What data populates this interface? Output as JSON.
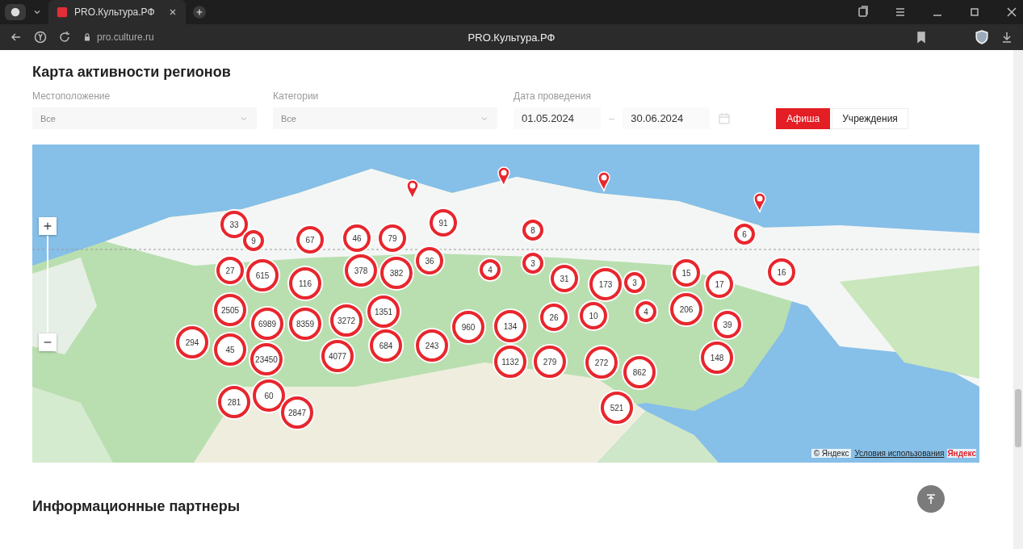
{
  "browser": {
    "tab_title": "PRO.Культура.РФ",
    "address": "pro.culture.ru",
    "page_title": "PRO.Культура.РФ"
  },
  "section_title": "Карта активности регионов",
  "filters": [
    {
      "kind": "select",
      "label": "Местоположение",
      "placeholder": "Все"
    },
    {
      "kind": "select",
      "label": "Категории",
      "placeholder": "Все"
    },
    {
      "kind": "dates",
      "label": "Дата проведения",
      "from": "01.05.2024",
      "separator": "–",
      "to": "30.06.2024"
    }
  ],
  "view_tabs": [
    {
      "label": "Афиша",
      "selected": true
    },
    {
      "label": "Учреждения",
      "selected": false
    }
  ],
  "map": {
    "markers": [
      {
        "kind": "pin"
      },
      {
        "kind": "pin"
      },
      {
        "kind": "pin"
      },
      {
        "kind": "pin"
      },
      {
        "kind": "cluster",
        "count": "33"
      },
      {
        "kind": "cluster",
        "count": "9"
      },
      {
        "kind": "cluster",
        "count": "67"
      },
      {
        "kind": "cluster",
        "count": "46"
      },
      {
        "kind": "cluster",
        "count": "79"
      },
      {
        "kind": "cluster",
        "count": "91"
      },
      {
        "kind": "cluster",
        "count": "8"
      },
      {
        "kind": "cluster",
        "count": "6"
      },
      {
        "kind": "cluster",
        "count": "27"
      },
      {
        "kind": "cluster",
        "count": "615"
      },
      {
        "kind": "cluster",
        "count": "116"
      },
      {
        "kind": "cluster",
        "count": "378"
      },
      {
        "kind": "cluster",
        "count": "382"
      },
      {
        "kind": "cluster",
        "count": "36"
      },
      {
        "kind": "cluster",
        "count": "4"
      },
      {
        "kind": "cluster",
        "count": "3"
      },
      {
        "kind": "cluster",
        "count": "31"
      },
      {
        "kind": "cluster",
        "count": "173"
      },
      {
        "kind": "cluster",
        "count": "3"
      },
      {
        "kind": "cluster",
        "count": "15"
      },
      {
        "kind": "cluster",
        "count": "17"
      },
      {
        "kind": "cluster",
        "count": "16"
      },
      {
        "kind": "cluster",
        "count": "2505"
      },
      {
        "kind": "cluster",
        "count": "6989"
      },
      {
        "kind": "cluster",
        "count": "8359"
      },
      {
        "kind": "cluster",
        "count": "3272"
      },
      {
        "kind": "cluster",
        "count": "1351"
      },
      {
        "kind": "cluster",
        "count": "960"
      },
      {
        "kind": "cluster",
        "count": "134"
      },
      {
        "kind": "cluster",
        "count": "26"
      },
      {
        "kind": "cluster",
        "count": "10"
      },
      {
        "kind": "cluster",
        "count": "4"
      },
      {
        "kind": "cluster",
        "count": "206"
      },
      {
        "kind": "cluster",
        "count": "39"
      },
      {
        "kind": "cluster",
        "count": "294"
      },
      {
        "kind": "cluster",
        "count": "45"
      },
      {
        "kind": "cluster",
        "count": "23450"
      },
      {
        "kind": "cluster",
        "count": "4077"
      },
      {
        "kind": "cluster",
        "count": "684"
      },
      {
        "kind": "cluster",
        "count": "243"
      },
      {
        "kind": "cluster",
        "count": "1132"
      },
      {
        "kind": "cluster",
        "count": "279"
      },
      {
        "kind": "cluster",
        "count": "272"
      },
      {
        "kind": "cluster",
        "count": "862"
      },
      {
        "kind": "cluster",
        "count": "148"
      },
      {
        "kind": "cluster",
        "count": "281"
      },
      {
        "kind": "cluster",
        "count": "60"
      },
      {
        "kind": "cluster",
        "count": "2847"
      },
      {
        "kind": "cluster",
        "count": "521"
      }
    ],
    "attribution": {
      "copyright": "© Яндекс",
      "terms_link": "Условия использования",
      "logo": "Яндекс"
    }
  },
  "partners_title": "Информационные партнеры"
}
